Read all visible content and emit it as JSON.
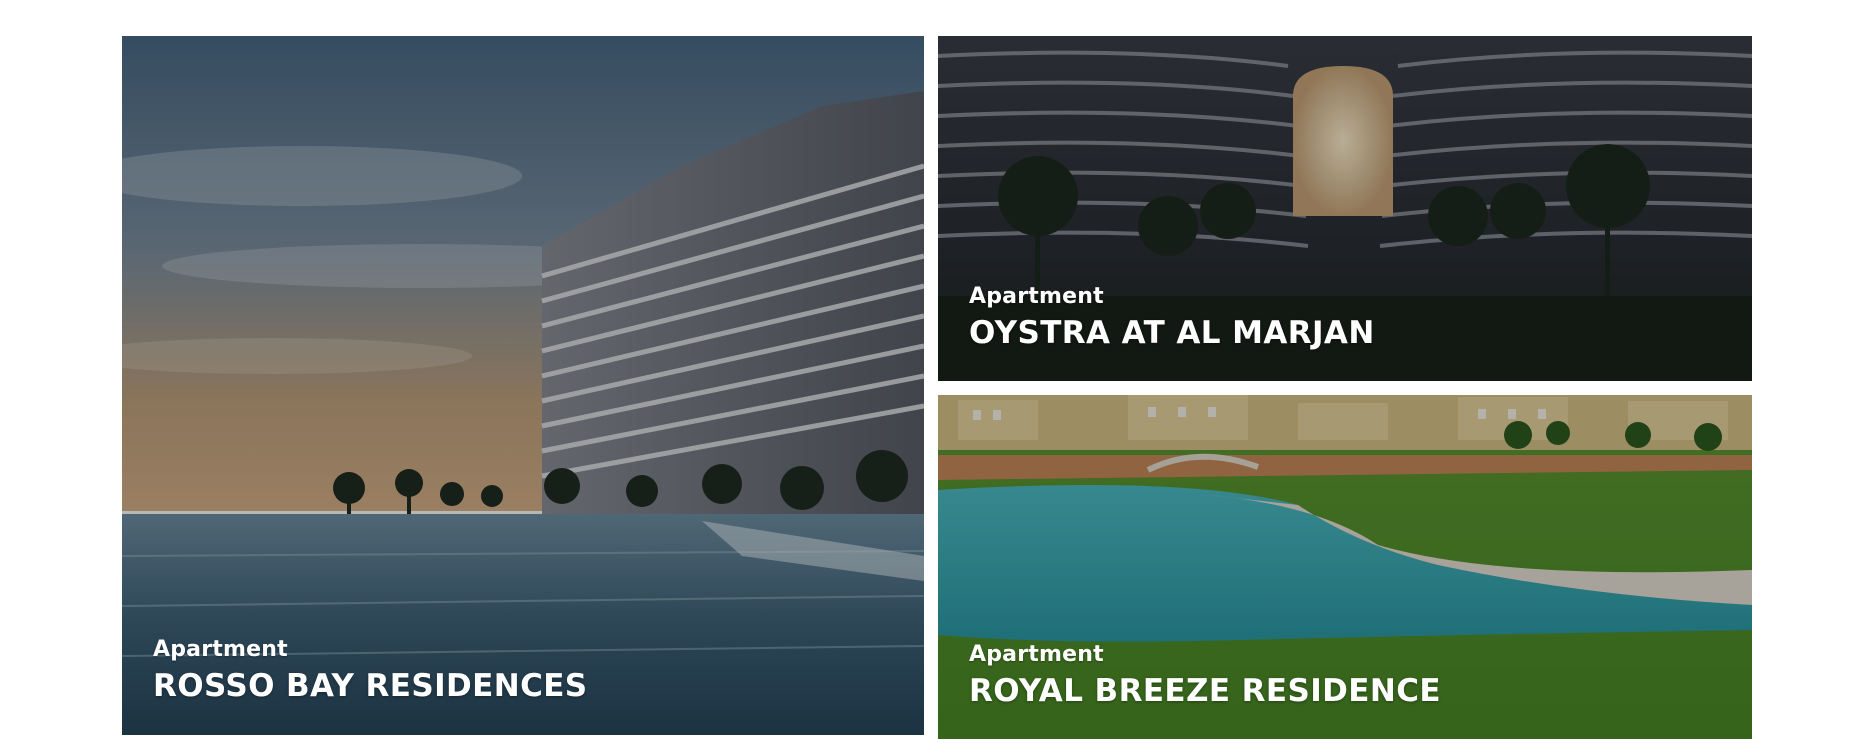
{
  "cards": [
    {
      "category": "Apartment",
      "title": "ROSSO BAY RESIDENCES"
    },
    {
      "category": "Apartment",
      "title": "OYSTRA AT AL MARJAN"
    },
    {
      "category": "Apartment",
      "title": "ROYAL BREEZE RESIDENCE"
    }
  ]
}
